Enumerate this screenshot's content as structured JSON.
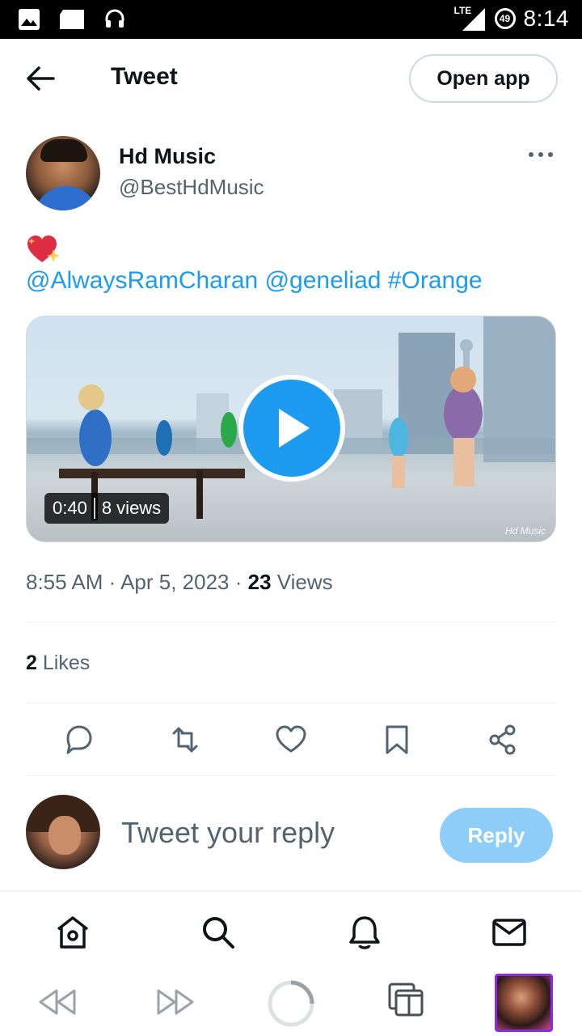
{
  "status_bar": {
    "time": "8:14",
    "network": "LTE",
    "battery": "49"
  },
  "header": {
    "title": "Tweet",
    "open_app_label": "Open app"
  },
  "tweet": {
    "author_name": "Hd Music",
    "author_handle": "@BestHdMusic",
    "emoji": "sparkling-heart",
    "mentions": [
      "@AlwaysRamCharan",
      "@geneliad",
      "#Orange"
    ],
    "video": {
      "duration": "0:40",
      "views": "8 views",
      "watermark": "Hd Music"
    },
    "time": "8:55 AM",
    "date": "Apr 5, 2023",
    "views_count": "23",
    "views_label": "Views",
    "likes_count": "2",
    "likes_label": "Likes"
  },
  "actions": [
    "reply-icon",
    "retweet-icon",
    "like-icon",
    "bookmark-icon",
    "share-icon"
  ],
  "reply": {
    "placeholder": "Tweet your reply",
    "button_label": "Reply"
  },
  "colors": {
    "accent": "#1d9bf0",
    "reply_button": "#8ecdf8",
    "secondary_text": "#536471",
    "primary_text": "#0f1419"
  }
}
